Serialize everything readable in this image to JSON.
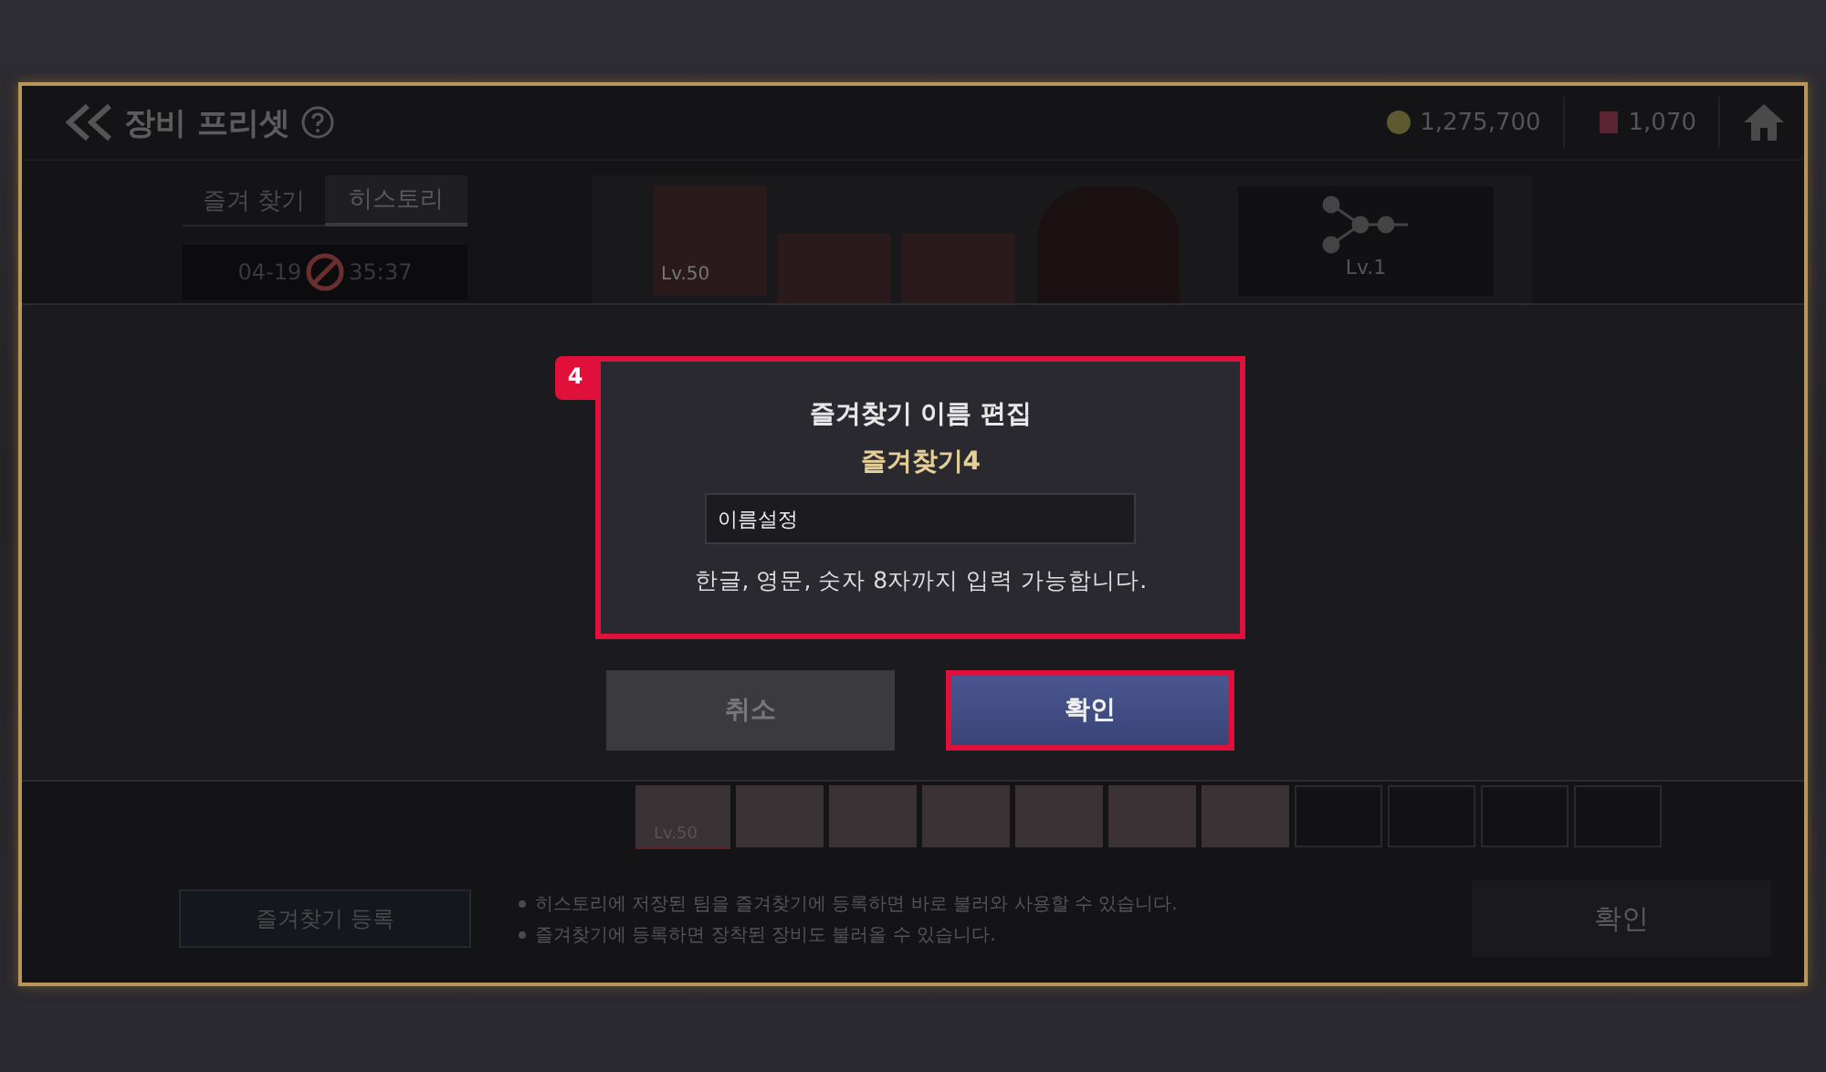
{
  "header": {
    "title": "장비 프리셋",
    "gold": "1,275,700",
    "tickets": "1,070"
  },
  "tabs": [
    {
      "label": "즐겨 찾기",
      "selected": false
    },
    {
      "label": "히스토리",
      "selected": true
    }
  ],
  "history_entry": {
    "date": "04-19",
    "time": "35:37"
  },
  "portraits": [
    {
      "kind": "raised",
      "level": "Lv.50"
    },
    {
      "kind": "lowered"
    },
    {
      "kind": "lowered"
    }
  ],
  "skill_tree": {
    "level": "Lv.1"
  },
  "slots": [
    {
      "level": "Lv.50",
      "filled": true
    },
    {
      "filled": true
    },
    {
      "filled": true
    },
    {
      "filled": true
    },
    {
      "filled": true
    },
    {
      "filled": true
    },
    {
      "filled": true
    },
    {
      "filled": false
    },
    {
      "filled": false
    },
    {
      "filled": false
    },
    {
      "filled": false
    }
  ],
  "dialog": {
    "step": "4",
    "highlighted": true,
    "title": "즐겨찾기 이름 편집",
    "name": "즐겨찾기4",
    "input": {
      "value": "이름설정"
    },
    "hint": "한글, 영문, 숫자 8자까지 입력 가능합니다.",
    "buttons": [
      {
        "label": "취소",
        "kind": "cancel",
        "highlighted": false
      },
      {
        "label": "확인",
        "kind": "confirm",
        "highlighted": true
      }
    ]
  },
  "footer": {
    "register_button": "즐겨찾기 등록",
    "notes": [
      "히스토리에 저장된 팀을 즐겨찾기에 등록하면 바로 불러와 사용할 수 있습니다.",
      "즐겨찾기에 등록하면 장착된 장비도 불러올 수 있습니다."
    ],
    "confirm_button": "확인"
  }
}
